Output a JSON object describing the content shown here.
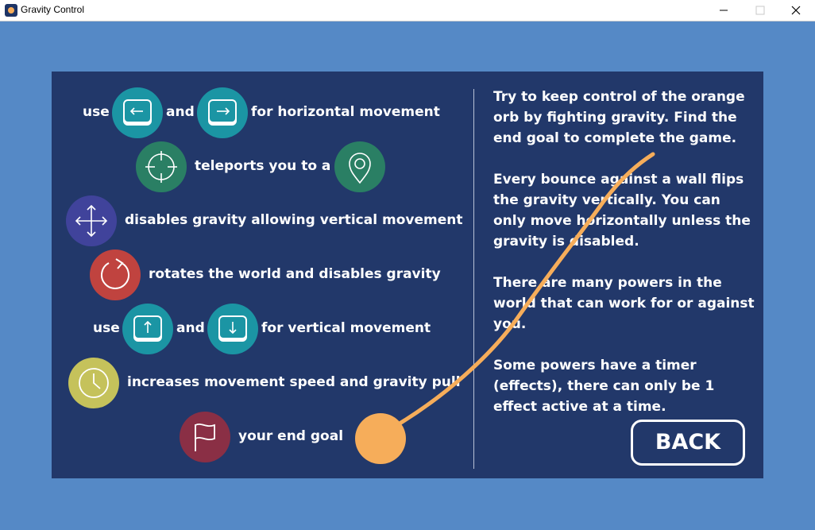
{
  "window": {
    "title": "Gravity Control"
  },
  "help": {
    "row1": {
      "prefix": "use",
      "and": "and",
      "suffix": "for horizontal movement"
    },
    "row2": {
      "text": "teleports you to a"
    },
    "row3": {
      "text": "disables gravity allowing vertical movement"
    },
    "row4": {
      "text": "rotates the world and disables gravity"
    },
    "row5": {
      "prefix": "use",
      "and": "and",
      "suffix": "for vertical movement"
    },
    "row6": {
      "text": "increases movement speed and gravity pull"
    },
    "row7": {
      "text": "your end goal"
    }
  },
  "instructions": {
    "p1": "Try to keep control of the orange orb by fighting gravity. Find the end goal to complete the game.",
    "p2": "Every bounce against a wall flips the gravity vertically. You can only move horizontally unless the gravity is disabled.",
    "p3": "There are many powers in the world that can work for or against you.",
    "p4": "Some powers have a timer (effects), there can only be 1 effect active at a time."
  },
  "back_button": {
    "label": "BACK"
  },
  "colors": {
    "background": "#5589c6",
    "panel": "#22386a",
    "teal": "#1b95a4",
    "green": "#2a7f64",
    "purple": "#40439b",
    "red": "#c0433f",
    "yellow": "#c5c25b",
    "maroon": "#8a2f45",
    "orb": "#f6ad5a"
  },
  "icons": [
    "app-icon",
    "minimize-icon",
    "maximize-icon",
    "close-icon",
    "left-arrow-key-icon",
    "right-arrow-key-icon",
    "crosshair-icon",
    "location-pin-icon",
    "move-arrows-icon",
    "rotate-icon",
    "up-arrow-key-icon",
    "down-arrow-key-icon",
    "clock-icon",
    "flag-icon"
  ]
}
